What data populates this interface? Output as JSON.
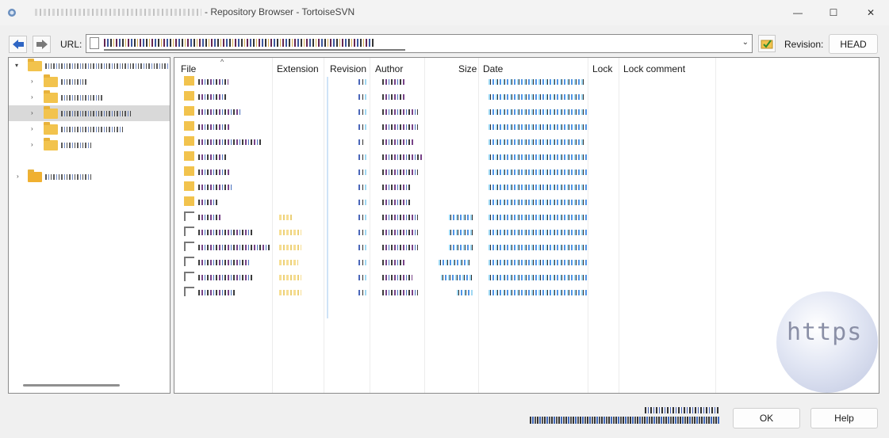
{
  "window": {
    "title": "- Repository Browser - TortoiseSVN",
    "controls": {
      "minimize": "—",
      "maximize": "☐",
      "close": "✕"
    }
  },
  "toolbar": {
    "url_label": "URL:",
    "url_value": "",
    "revision_label": "Revision:",
    "revision_value": "HEAD"
  },
  "tree": {
    "items": [
      {
        "level": 0,
        "expanded": true,
        "type": "root"
      },
      {
        "level": 1,
        "type": "folder"
      },
      {
        "level": 1,
        "type": "folder"
      },
      {
        "level": 1,
        "type": "folder",
        "selected": true
      },
      {
        "level": 1,
        "type": "folder"
      },
      {
        "level": 1,
        "type": "folder"
      },
      {
        "level": 0,
        "type": "root"
      }
    ]
  },
  "list": {
    "columns": [
      "File",
      "Extension",
      "Revision",
      "Author",
      "Size",
      "Date",
      "Lock",
      "Lock comment"
    ],
    "rows": [
      {
        "type": "dir"
      },
      {
        "type": "dir"
      },
      {
        "type": "dir"
      },
      {
        "type": "dir"
      },
      {
        "type": "dir"
      },
      {
        "type": "dir"
      },
      {
        "type": "dir"
      },
      {
        "type": "dir"
      },
      {
        "type": "dir"
      },
      {
        "type": "file"
      },
      {
        "type": "file"
      },
      {
        "type": "file"
      },
      {
        "type": "file"
      },
      {
        "type": "file"
      },
      {
        "type": "file"
      }
    ]
  },
  "watermark": {
    "text": "https"
  },
  "buttons": {
    "ok": "OK",
    "help": "Help"
  },
  "colors": {
    "folder": "#f2c34d",
    "selection": "#d9d9d9"
  }
}
